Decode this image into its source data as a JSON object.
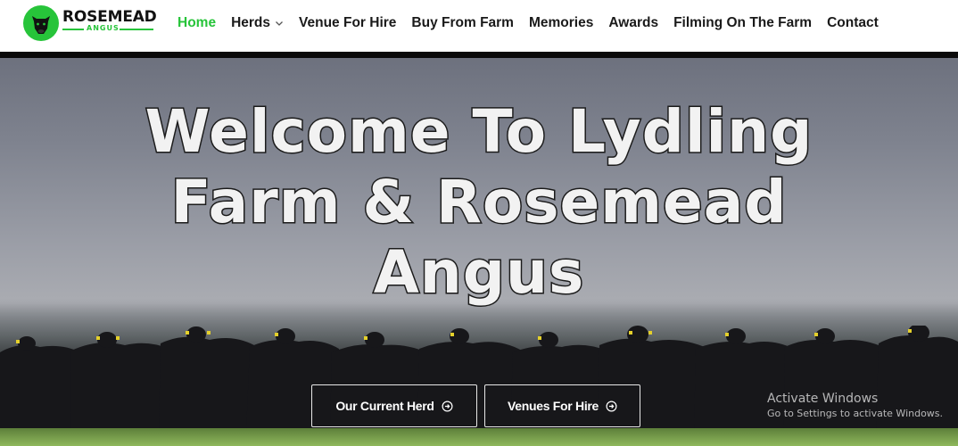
{
  "logo": {
    "title": "ROSEMEAD",
    "subtitle": "ANGUS",
    "icon": "cow-head-icon"
  },
  "nav": {
    "items": [
      {
        "label": "Home",
        "active": true
      },
      {
        "label": "Herds",
        "dropdown": true
      },
      {
        "label": "Venue For Hire"
      },
      {
        "label": "Buy From Farm"
      },
      {
        "label": "Memories"
      },
      {
        "label": "Awards"
      },
      {
        "label": "Filming On The Farm"
      },
      {
        "label": "Contact"
      }
    ]
  },
  "hero": {
    "title_line1": "Welcome To Lydling",
    "title_line2": "Farm & Rosemead",
    "title_line3": "Angus",
    "buttons": [
      {
        "label": "Our Current Herd",
        "icon": "arrow-circle-right-icon"
      },
      {
        "label": "Venues For Hire",
        "icon": "arrow-circle-right-icon"
      }
    ]
  },
  "watermark": {
    "line1": "Activate Windows",
    "line2": "Go to Settings to activate Windows."
  },
  "colors": {
    "accent": "#27c43a",
    "text": "#1a1a1a",
    "header_rule": "#0a0a0a"
  }
}
